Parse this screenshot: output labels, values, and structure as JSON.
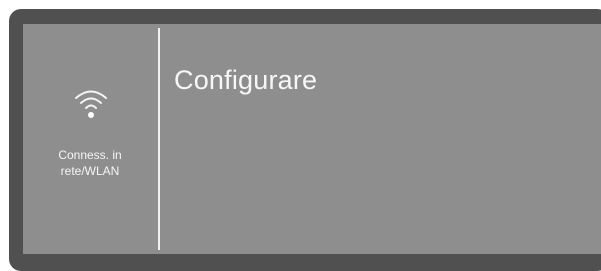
{
  "left_panel": {
    "icon": "wifi-icon",
    "label": "Conness. in\nrete/WLAN"
  },
  "main": {
    "title": "Configurare"
  },
  "colors": {
    "frame": "#505050",
    "screen": "#8e8e8e",
    "text": "#f7f7f7",
    "divider": "#f2f2f2"
  }
}
